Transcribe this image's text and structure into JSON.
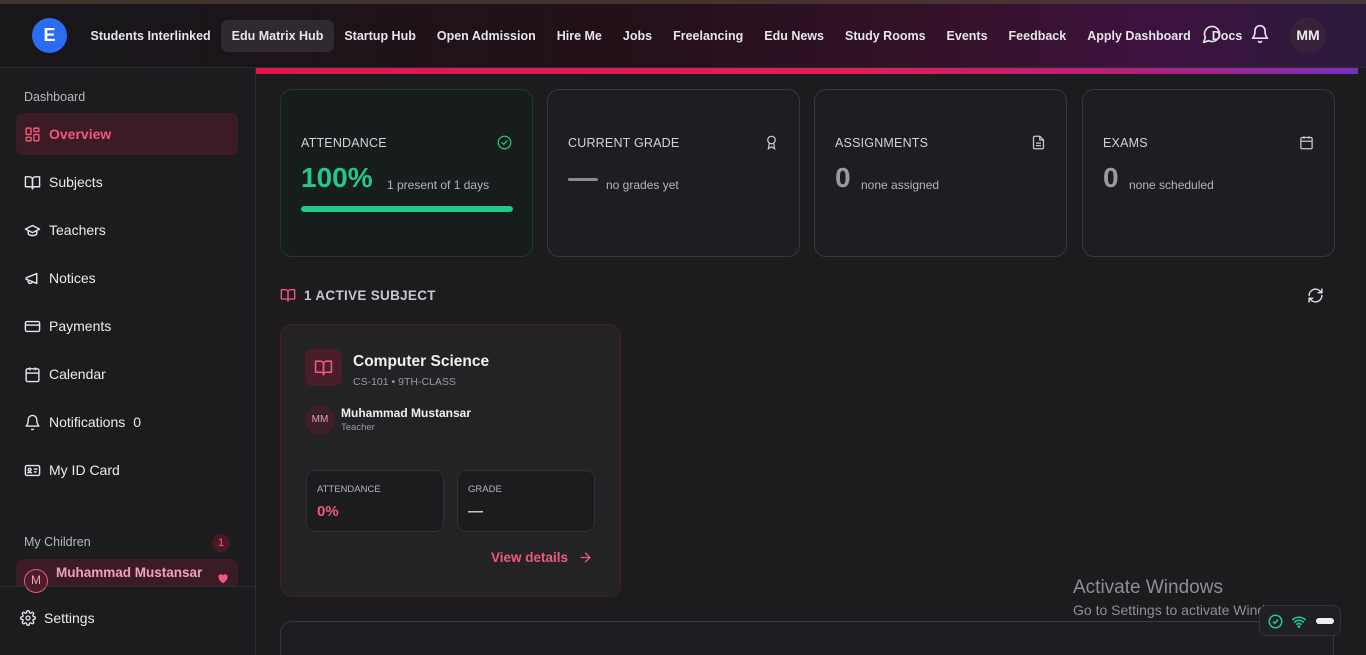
{
  "topbar": {
    "logo_text": "E",
    "nav": [
      {
        "label": "Students Interlinked",
        "active": false
      },
      {
        "label": "Edu Matrix Hub",
        "active": true
      },
      {
        "label": "Startup Hub",
        "active": false
      },
      {
        "label": "Open Admission",
        "active": false
      },
      {
        "label": "Hire Me",
        "active": false
      },
      {
        "label": "Jobs",
        "active": false
      },
      {
        "label": "Freelancing",
        "active": false
      },
      {
        "label": "Edu News",
        "active": false
      },
      {
        "label": "Study Rooms",
        "active": false
      },
      {
        "label": "Events",
        "active": false
      },
      {
        "label": "Feedback",
        "active": false
      },
      {
        "label": "Apply Dashboard",
        "active": false
      },
      {
        "label": "Docs",
        "active": false
      }
    ],
    "icons": [
      "chat-icon",
      "bell-icon"
    ],
    "user_initials": "MM"
  },
  "sidebar": {
    "heading": "Dashboard",
    "items": [
      {
        "label": "Overview",
        "icon": "grid-icon",
        "active": true
      },
      {
        "label": "Subjects",
        "icon": "book-icon"
      },
      {
        "label": "Teachers",
        "icon": "graduation-cap-icon"
      },
      {
        "label": "Notices",
        "icon": "megaphone-icon"
      },
      {
        "label": "Payments",
        "icon": "credit-card-icon"
      },
      {
        "label": "Calendar",
        "icon": "calendar-icon"
      },
      {
        "label": "Notifications",
        "icon": "bell-icon",
        "count": "0"
      },
      {
        "label": "My ID Card",
        "icon": "id-card-icon"
      }
    ],
    "children_heading": "My Children",
    "children_count": "1",
    "child": {
      "initial": "M",
      "name": "Muhammad Mustansar"
    },
    "settings_label": "Settings"
  },
  "stats": [
    {
      "label": "ATTENDANCE",
      "value": "100%",
      "sub": "1 present of 1 days",
      "icon": "check-circle-icon",
      "progress": 1.0
    },
    {
      "label": "CURRENT GRADE",
      "value": "—",
      "sub": "no grades yet",
      "icon": "award-icon"
    },
    {
      "label": "ASSIGNMENTS",
      "value": "0",
      "sub": "none assigned",
      "icon": "document-icon"
    },
    {
      "label": "EXAMS",
      "value": "0",
      "sub": "none scheduled",
      "icon": "calendar-icon"
    }
  ],
  "subjects_section": {
    "title": "1 ACTIVE SUBJECT",
    "subject": {
      "name": "Computer Science",
      "code": "CS-101 • 9TH-CLASS",
      "teacher_initials": "MM",
      "teacher_name": "Muhammad Mustansar",
      "teacher_role": "Teacher",
      "attendance_label": "ATTENDANCE",
      "attendance_value": "0%",
      "grade_label": "GRADE",
      "grade_value": "—",
      "view_details": "View details"
    }
  },
  "watermark": {
    "title": "Activate Windows",
    "subtitle": "Go to Settings to activate Windows."
  },
  "colors": {
    "accent": "#f0587e",
    "success": "#22c98a",
    "brand": "#2a6df4"
  }
}
